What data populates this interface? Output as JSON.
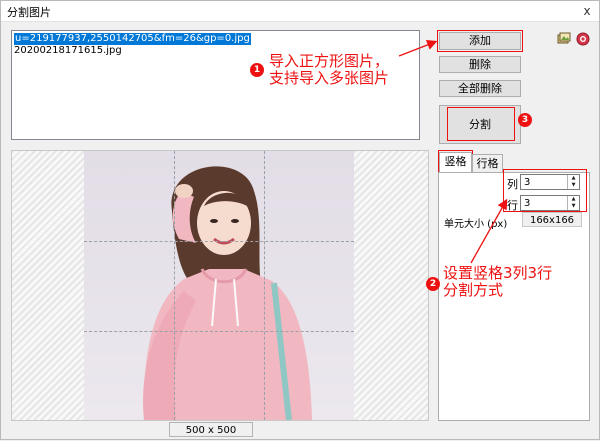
{
  "window": {
    "title": "分割图片",
    "close_glyph": "x"
  },
  "file_list": [
    {
      "name": "u=219177937,2550142705&fm=26&gp=0.jpg",
      "selected": true
    },
    {
      "name": "20200218171615.jpg",
      "selected": false
    }
  ],
  "buttons": {
    "add": "添加",
    "delete": "删除",
    "delete_all": "全部删除",
    "split": "分割"
  },
  "icons": [
    "picture-icon",
    "help-icon"
  ],
  "tabs": [
    {
      "label": "竖格",
      "active": true
    },
    {
      "label": "行格",
      "active": false
    }
  ],
  "grid": {
    "columns_label": "列",
    "columns_value": "3",
    "rows_label": "行",
    "rows_value": "3",
    "unit_size_label": "单元大小 (px)",
    "unit_size_value": "166x166"
  },
  "preview": {
    "size_label": "500 x 500"
  },
  "annotations": [
    {
      "badge": "1",
      "lines": [
        "导入正方形图片，",
        "支持导入多张图片"
      ]
    },
    {
      "badge": "2",
      "lines": [
        "设置竖格3列3行",
        "分割方式"
      ]
    },
    {
      "badge": "3",
      "lines": []
    }
  ],
  "colors": {
    "annotation_red": "#ee1111",
    "selection_blue": "#0078d7",
    "shirt_pink": "#f2b8c2"
  }
}
